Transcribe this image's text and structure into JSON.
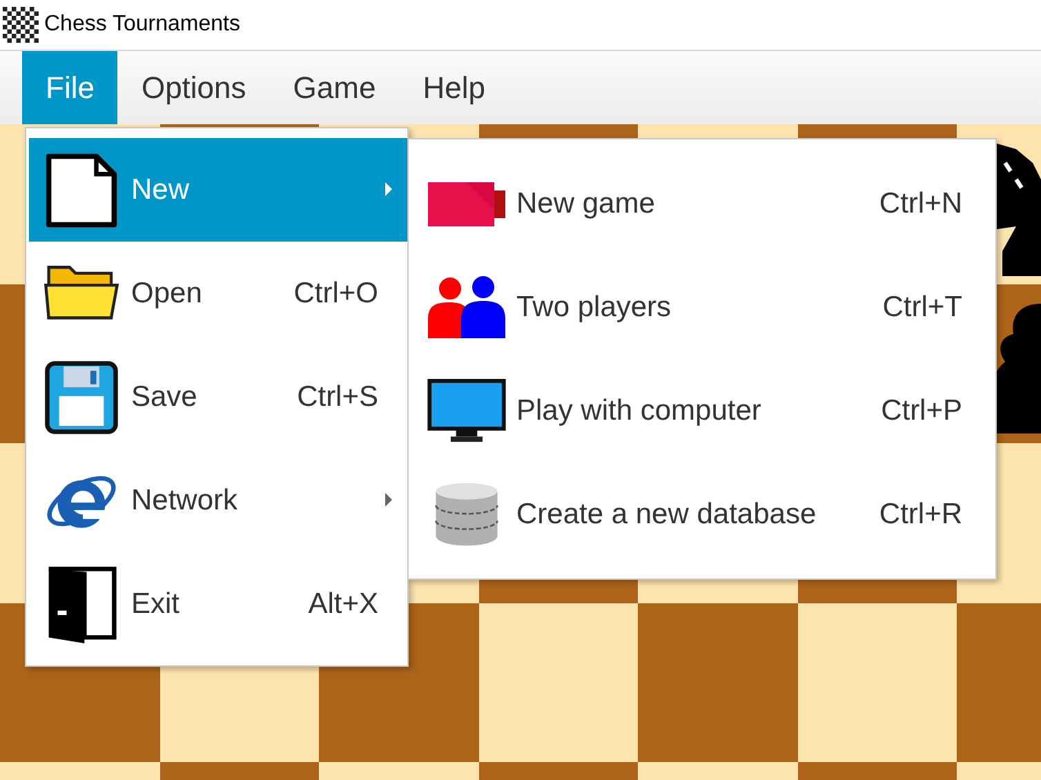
{
  "window": {
    "title": "Chess Tournaments"
  },
  "menubar": {
    "items": [
      {
        "label": "File",
        "selected": true
      },
      {
        "label": "Options",
        "selected": false
      },
      {
        "label": "Game",
        "selected": false
      },
      {
        "label": "Help",
        "selected": false
      }
    ]
  },
  "file_menu": {
    "items": [
      {
        "kind": "new",
        "label": "New",
        "submenu": true,
        "selected": true
      },
      {
        "kind": "open",
        "label": "Open",
        "shortcut": "Ctrl+O",
        "submenu": false,
        "selected": false
      },
      {
        "kind": "save",
        "label": "Save",
        "shortcut": "Ctrl+S",
        "submenu": false,
        "selected": false
      },
      {
        "kind": "network",
        "label": "Network",
        "submenu": true,
        "selected": false
      },
      {
        "kind": "exit",
        "label": "Exit",
        "shortcut": "Alt+X",
        "submenu": false,
        "selected": false
      }
    ]
  },
  "new_submenu": {
    "items": [
      {
        "kind": "game",
        "label": "New game",
        "shortcut": "Ctrl+N",
        "selected": false
      },
      {
        "kind": "players",
        "label": "Two players",
        "shortcut": "Ctrl+T",
        "selected": false
      },
      {
        "kind": "computer",
        "label": "Play with computer",
        "shortcut": "Ctrl+P",
        "selected": false
      },
      {
        "kind": "database",
        "label": "Create a new database",
        "shortcut": "Ctrl+R",
        "selected": false
      }
    ]
  }
}
